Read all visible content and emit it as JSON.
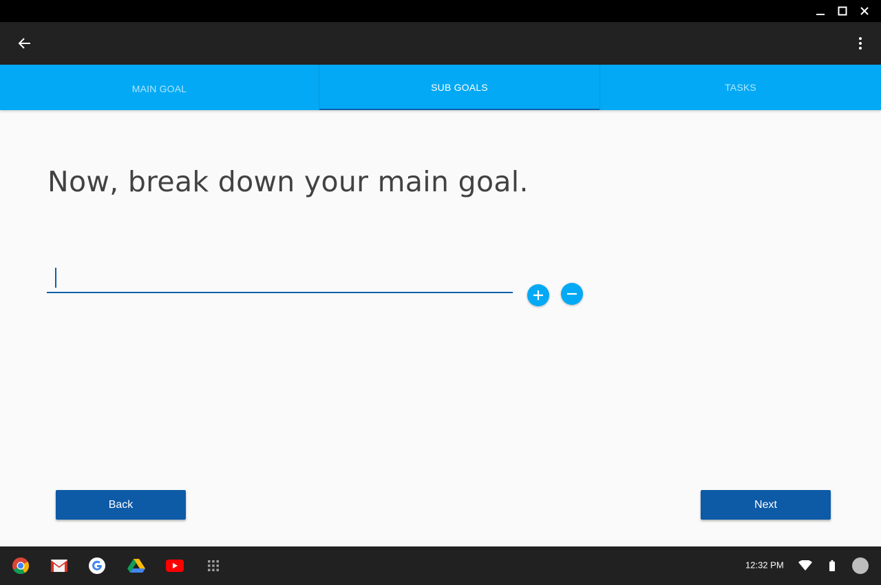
{
  "window": {
    "minimize_icon": "minimize-icon",
    "maximize_icon": "maximize-icon",
    "close_icon": "close-icon"
  },
  "appbar": {
    "back_icon": "arrow-left-icon",
    "menu_icon": "more-vertical-icon",
    "color": "#222222"
  },
  "tabs": [
    {
      "label": "MAIN GOAL",
      "selected": false
    },
    {
      "label": "SUB GOALS",
      "selected": true
    },
    {
      "label": "TASKS",
      "selected": false
    }
  ],
  "main": {
    "heading": "Now, break down your main goal.",
    "subgoal_input": {
      "value": "",
      "placeholder": ""
    },
    "add_icon": "plus-circle-icon",
    "remove_icon": "minus-circle-icon"
  },
  "buttons": {
    "back_label": "Back",
    "next_label": "Next"
  },
  "shelf": {
    "apps": [
      "chrome-icon",
      "gmail-icon",
      "google-icon",
      "drive-icon",
      "youtube-icon",
      "app-launcher-icon"
    ],
    "time": "12:32 PM",
    "wifi_icon": "wifi-icon",
    "battery_icon": "battery-icon",
    "avatar": "avatar"
  },
  "colors": {
    "tab_bar": "#03a9f4",
    "accent": "#0d5aa7",
    "titlebar": "#000000"
  }
}
